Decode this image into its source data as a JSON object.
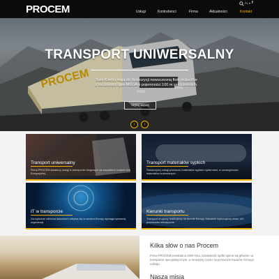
{
  "header": {
    "logo": "PROCEM",
    "lang": "PL ▾",
    "facebook": "f",
    "nav": [
      {
        "label": "Usługi"
      },
      {
        "label": "Kontrahenci"
      },
      {
        "label": "Firma"
      },
      {
        "label": "Aktualności"
      },
      {
        "label": "Kontakt"
      }
    ]
  },
  "hero": {
    "title": "TRANSPORT UNIWERSALNY",
    "subtitle_line1": "Nasi Klienci mają do dyspozycji nowoczesną flotę pojazdów",
    "subtitle_line2": "z naczepami typu MEGA o pojemności 100 m sześciennych.",
    "button": "czytaj więcej",
    "trailer_brand": "PROCEM",
    "prev": "‹",
    "next": "›"
  },
  "cards": [
    {
      "title": "Transport uniwersalny",
      "desc": "Firma PROCEM świadczy usługi w transporcie drogowym we wszystkich krajach Unii Europejskiej."
    },
    {
      "title": "Transport materiałów sypkich",
      "desc": "Świadczymy usługi przewozu materiałów sypkich cysternami, w szczególności materiałów budowlanych."
    },
    {
      "title": "IT w transporcie",
      "desc": "Zarządzanie wieloma ładunkami odbywa się w ramach Europy wymaga sprawnej organizacji."
    },
    {
      "title": "Kierunki transportu",
      "desc": "Transport drogowy realizujemy na terenie Europy. Aktualnie wykonujemy około 100 przewozów miesięcznie."
    }
  ],
  "about": {
    "title": "Kilka słów o nas Procem",
    "text": "Firma PROCEM powstała w 2009 roku. Działalność spółki opiera się głównie na transporcie specjalistycznym, w mniejszej części na przewozie towarów różnego rodzaju.",
    "mission_title": "Nasza misja"
  },
  "colors": {
    "accent": "#f6b400",
    "header_bg": "#0b0b0b"
  }
}
